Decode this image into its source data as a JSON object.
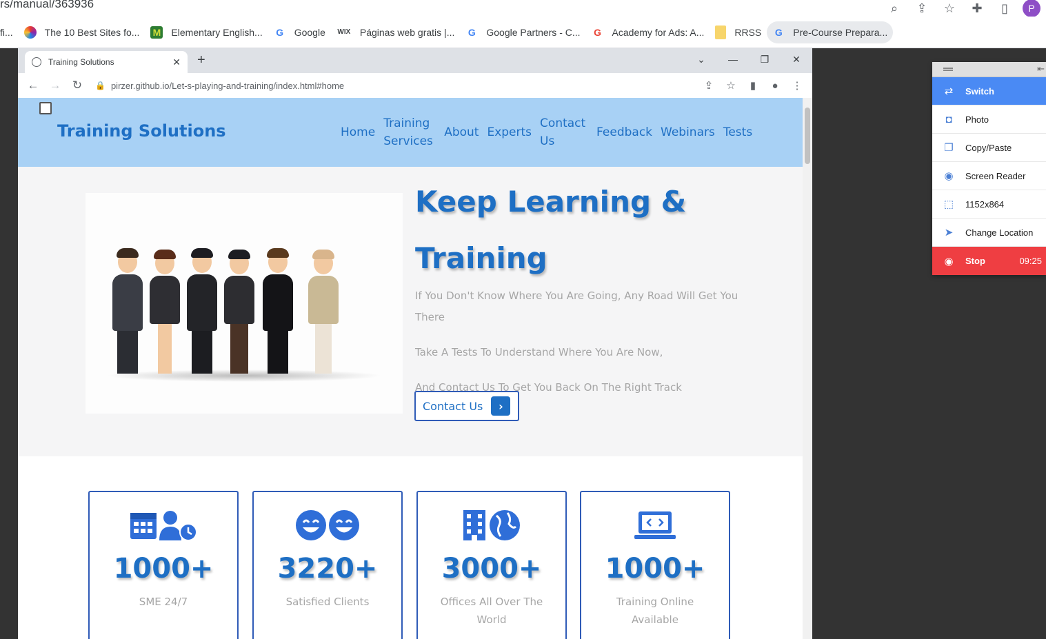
{
  "outer_browser": {
    "url": "rs/manual/363936",
    "profile_initial": "P",
    "bookmarks": [
      {
        "label": "fi...",
        "icon": "generic-icon",
        "color": "#5f6368"
      },
      {
        "label": "The 10 Best Sites fo...",
        "icon": "colorful-logo-icon",
        "color": "#e53935"
      },
      {
        "label": "Elementary English...",
        "icon": "m-logo-icon",
        "color": "#2e7d32"
      },
      {
        "label": "Google",
        "icon": "google-icon",
        "color": "#4285f4"
      },
      {
        "label": "Páginas web gratis |...",
        "icon": "wix-icon",
        "color": "#000000"
      },
      {
        "label": "Google Partners - C...",
        "icon": "google-icon",
        "color": "#4285f4"
      },
      {
        "label": "Academy for Ads: A...",
        "icon": "google-icon",
        "color": "#4285f4"
      },
      {
        "label": "RRSS",
        "icon": "folder-icon",
        "color": "#f7d56b"
      },
      {
        "label": "Pre-Course Prepara...",
        "icon": "google-icon",
        "color": "#4285f4"
      }
    ]
  },
  "inner_browser": {
    "tab_title": "Training Solutions",
    "address": "pirzer.github.io/Let-s-playing-and-training/index.html#home"
  },
  "site": {
    "brand": "Training Solutions",
    "menu": [
      "Home",
      "Training Services",
      "About",
      "Experts",
      "Contact Us",
      "Feedback",
      "Webinars",
      "Tests"
    ],
    "hero": {
      "title_line1": "Keep Learning &",
      "title_line2": "Training",
      "text1": "If You Don't Know Where You Are Going, Any Road Will Get You There",
      "text2": "Take A Tests To Understand Where You Are Now,",
      "text3": "And Contact Us To Get You Back On The Right Track",
      "cta": "Contact Us"
    },
    "stats": [
      {
        "number": "1000+",
        "label": "SME 24/7",
        "icon": "calendar-person-clock-icon"
      },
      {
        "number": "3220+",
        "label": "Satisfied Clients",
        "icon": "smiley-faces-icon"
      },
      {
        "number": "3000+",
        "label": "Offices All Over The World",
        "icon": "building-globe-icon"
      },
      {
        "number": "1000+",
        "label": "Training Online Available",
        "icon": "laptop-code-icon"
      }
    ]
  },
  "side_panel": {
    "items": [
      {
        "label": "Switch",
        "icon": "switch-arrows-icon"
      },
      {
        "label": "Photo",
        "icon": "camera-icon"
      },
      {
        "label": "Copy/Paste",
        "icon": "clipboard-icon"
      },
      {
        "label": "Screen Reader",
        "icon": "accessibility-icon"
      },
      {
        "label": "1152x864",
        "icon": "resolution-icon"
      },
      {
        "label": "Change Location",
        "icon": "location-arrow-icon"
      },
      {
        "label": "Stop",
        "icon": "stop-record-icon"
      }
    ],
    "timer": "09:25"
  },
  "colors": {
    "brand_blue": "#1e6fc4",
    "nav_bg": "#a8d1f5",
    "card_border": "#2f5bb7",
    "switch_bg": "#4a8af4",
    "stop_bg": "#ef3e42"
  }
}
